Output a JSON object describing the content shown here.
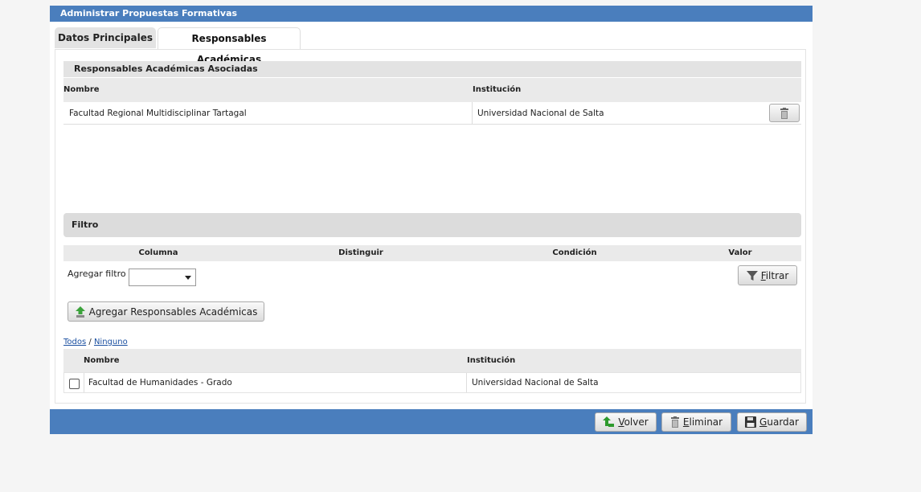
{
  "window": {
    "title": "Administrar Propuestas Formativas"
  },
  "tabs": [
    {
      "label": "Datos Principales",
      "active": false
    },
    {
      "label": "Responsables Académicas",
      "active": true
    }
  ],
  "asociadas": {
    "title": "Responsables Académicas Asociadas",
    "columns": {
      "nombre": "Nombre",
      "institucion": "Institución"
    },
    "rows": [
      {
        "nombre": "Facultad Regional Multidisciplinar Tartagal",
        "institucion": "Universidad Nacional de Salta",
        "action_icon": "trash-icon"
      }
    ]
  },
  "filtro": {
    "title": "Filtro",
    "columns": {
      "columna": "Columna",
      "distinguir": "Distinguir",
      "condicion": "Condición",
      "valor": "Valor"
    },
    "add_label": "Agregar filtro",
    "select_value": "",
    "filter_button": {
      "first": "F",
      "rest": "iltrar",
      "icon": "funnel-icon"
    }
  },
  "agregar_button": {
    "label": "Agregar Responsables Académicas",
    "icon": "add-arrow-icon"
  },
  "selection_links": {
    "all": "Todos",
    "separator": "/",
    "none": "Ninguno"
  },
  "disponibles": {
    "columns": {
      "nombre": "Nombre",
      "institucion": "Institución"
    },
    "rows": [
      {
        "nombre": "Facultad de Humanidades - Grado",
        "institucion": "Universidad Nacional de Salta",
        "checked": false
      }
    ]
  },
  "footer": {
    "volver": {
      "first": "V",
      "rest": "olver",
      "icon": "back-arrow-icon"
    },
    "eliminar": {
      "first": "E",
      "rest": "liminar",
      "icon": "trash-icon"
    },
    "guardar": {
      "first": "G",
      "rest": "uardar",
      "icon": "floppy-icon"
    }
  },
  "colors": {
    "accent": "#4a7ebd",
    "header_gray": "#e3e3e3",
    "link": "#1a4fa0"
  }
}
